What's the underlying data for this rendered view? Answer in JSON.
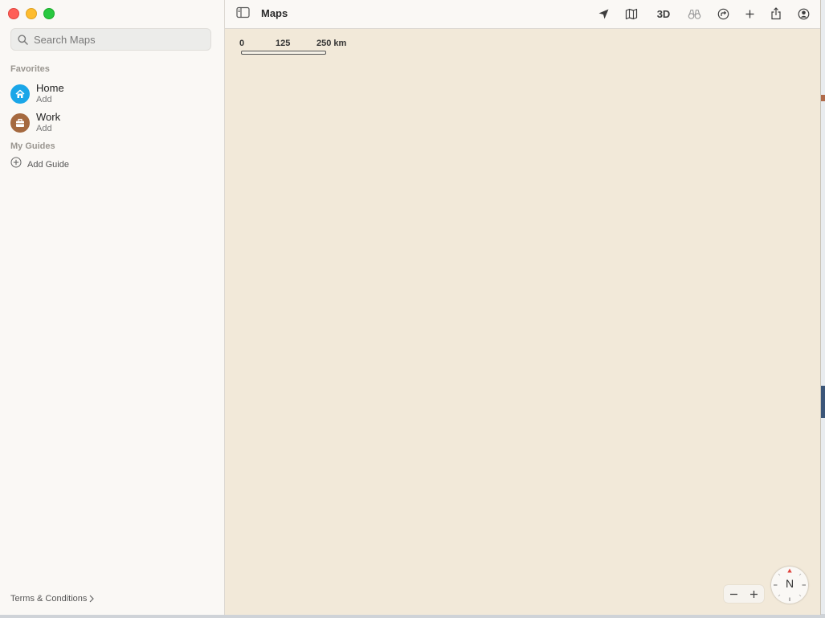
{
  "window": {
    "title": "Maps"
  },
  "sidebar": {
    "search": {
      "placeholder": "Search Maps",
      "value": ""
    },
    "favorites_label": "Favorites",
    "favorites": [
      {
        "title": "Home",
        "subtitle": "Add",
        "icon": "house-icon",
        "color": "#1aa6e8"
      },
      {
        "title": "Work",
        "subtitle": "Add",
        "icon": "briefcase-icon",
        "color": "#a5693f"
      }
    ],
    "guides_label": "My Guides",
    "add_guide_label": "Add Guide",
    "terms_label": "Terms & Conditions"
  },
  "toolbar": {
    "title": "Maps",
    "buttons": [
      {
        "name": "location-arrow-icon"
      },
      {
        "name": "map-mode-icon"
      },
      {
        "name": "3d-button",
        "label": "3D"
      },
      {
        "name": "look-around-binoculars-icon"
      },
      {
        "name": "directions-icon"
      },
      {
        "name": "add-icon"
      },
      {
        "name": "share-icon"
      },
      {
        "name": "account-icon"
      }
    ]
  },
  "map": {
    "background": "#f2e9d9",
    "scale": {
      "labels": [
        "0",
        "125",
        "250 km"
      ]
    },
    "compass_label": "N"
  }
}
